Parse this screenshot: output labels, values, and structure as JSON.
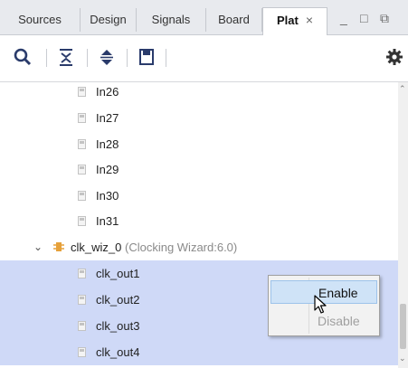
{
  "tabs": [
    {
      "label": "Sources"
    },
    {
      "label": "Design"
    },
    {
      "label": "Signals"
    },
    {
      "label": "Board"
    },
    {
      "label": "Plat",
      "active": true,
      "close": "×"
    }
  ],
  "window_buttons": {
    "minimize": "_",
    "maximize": "□",
    "restore": "⧉"
  },
  "toolbar": {
    "icons": [
      "search-icon",
      "collapse-all-icon",
      "expand-all-icon",
      "save-icon",
      "gear-icon"
    ]
  },
  "tree": {
    "pins": [
      "In26",
      "In27",
      "In28",
      "In29",
      "In30",
      "In31"
    ],
    "group": {
      "name": "clk_wiz_0",
      "detail": "(Clocking Wizard:6.0)",
      "expanded": true
    },
    "outputs": [
      "clk_out1",
      "clk_out2",
      "clk_out3",
      "clk_out4"
    ]
  },
  "context_menu": {
    "items": [
      {
        "label": "Enable",
        "enabled": true,
        "hovered": true
      },
      {
        "label": "Disable",
        "enabled": false
      }
    ]
  },
  "colors": {
    "selection": "#cfd9f7",
    "menu_hover": "#cfe3f7",
    "gear": "#333333"
  }
}
